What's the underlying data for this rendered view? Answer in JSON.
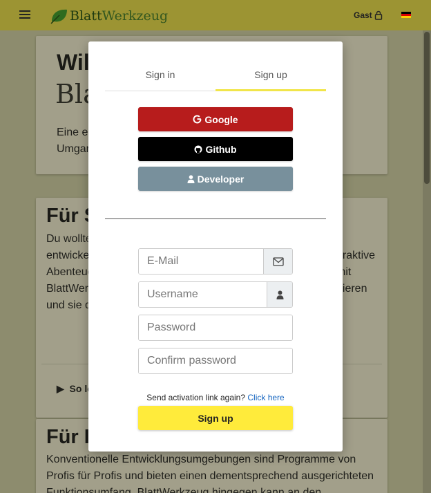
{
  "navbar": {
    "logo_part1": "Blatt",
    "logo_part2": "Werkzeug",
    "user_label": "Gast"
  },
  "background": {
    "card1_heading": "Wil",
    "card1_heading2": "Bla",
    "card1_text_line1": "Eine ei",
    "card1_text_line2": "Umgar",
    "card2_heading": "Für S",
    "card2_text_lines": [
      "Du wollte",
      "entwicke",
      "Abenteue",
      "BlattWer",
      "und sie d"
    ],
    "card2_text_right": [
      "eraktive",
      "mit",
      "nieren"
    ],
    "card2_details": "So le",
    "card3_heading": "Für I",
    "card3_text_line1": "Konventionelle Entwicklungsumgebungen sind Programme von",
    "card3_text_line2": "Profis für Profis und bieten einen dementsprechend ausgerichteten",
    "card3_text_line3": "Funktionsumfang. BlattWerkzeug hingegen kann an den"
  },
  "modal": {
    "tabs": [
      {
        "label": "Sign in"
      },
      {
        "label": "Sign up"
      }
    ],
    "oauth": {
      "google": "Google",
      "github": "Github",
      "developer": "Developer"
    },
    "fields": {
      "email_placeholder": "E-Mail",
      "username_placeholder": "Username",
      "password_placeholder": "Password",
      "confirm_placeholder": "Confirm password"
    },
    "resend_text": "Send activation link again?",
    "resend_link": "Click here",
    "submit_label": "Sign up"
  },
  "colors": {
    "navbar": "#9c9433",
    "google": "#b71c1c",
    "github": "#000000",
    "developer": "#78909c",
    "submit": "#ffeb3b",
    "tab_active_underline": "#f1e54a"
  }
}
